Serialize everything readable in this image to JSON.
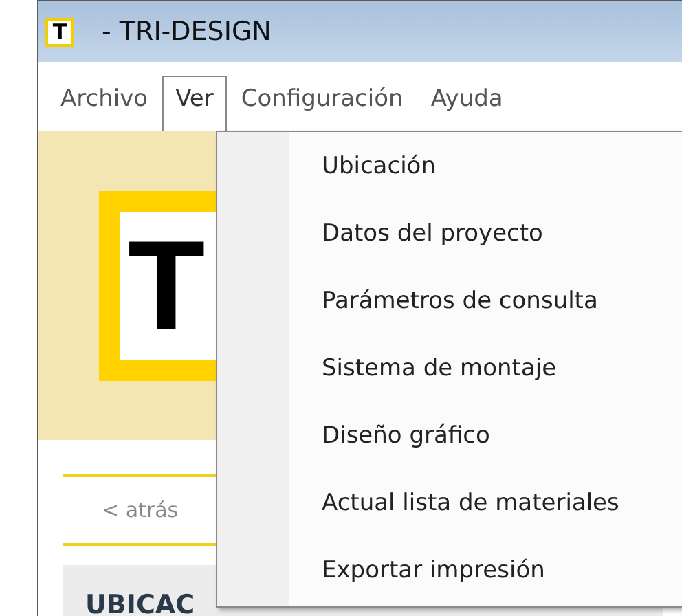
{
  "window": {
    "icon_letter": "T",
    "title": "- TRI-DESIGN"
  },
  "menu_bar": [
    {
      "label": "Archivo",
      "selected": false
    },
    {
      "label": "Ver",
      "selected": true
    },
    {
      "label": "Configuración",
      "selected": false
    },
    {
      "label": "Ayuda",
      "selected": false
    }
  ],
  "logo": {
    "letter": "T"
  },
  "back_link": "< atrás",
  "section_title": "UBICAC",
  "dropdown": [
    "Ubicación",
    "Datos del proyecto",
    "Parámetros de consulta",
    "Sistema de montaje",
    "Diseño gráfico",
    "Actual lista de materiales",
    "Exportar impresión"
  ]
}
